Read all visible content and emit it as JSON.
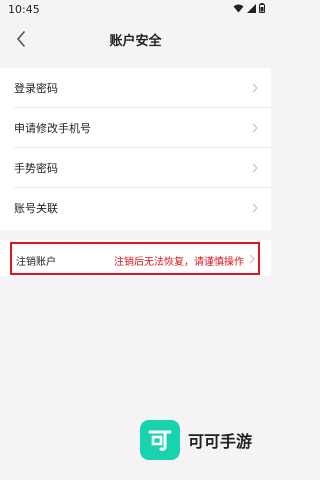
{
  "status_bar": {
    "time": "10:45",
    "icons": [
      "wifi-icon",
      "signal-icon",
      "battery-icon"
    ]
  },
  "header": {
    "title": "账户安全",
    "back_icon": "chevron-left-icon"
  },
  "menu": {
    "items": [
      {
        "label": "登录密码"
      },
      {
        "label": "申请修改手机号"
      },
      {
        "label": "手势密码"
      },
      {
        "label": "账号关联"
      }
    ]
  },
  "cancel_account": {
    "label": "注销账户",
    "warning": "注销后无法恢复，请谨慎操作"
  },
  "watermark": {
    "logo_char": "可",
    "brand": "可可手游"
  },
  "colors": {
    "background": "#f4f4f6",
    "accent_red": "#e0141e",
    "brand_green": "#18d3ae"
  }
}
